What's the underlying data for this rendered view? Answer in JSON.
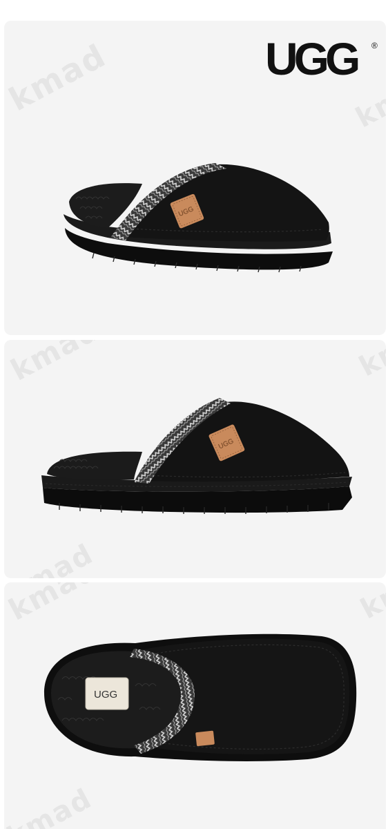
{
  "brand": {
    "logo_text": "UGG",
    "registered_mark": "®"
  },
  "watermark": {
    "text": "kmad"
  },
  "colors": {
    "background": "#ffffff",
    "panel": "#f4f4f4",
    "shoe_black": "#121212",
    "fur": "#1c1c1c",
    "trim_light": "#cfcfcf",
    "trim_dark": "#3a3a3a",
    "leather_tag": "#c98a5c",
    "fabric_label": "#ece6da"
  },
  "panels": [
    {
      "view": "side-angle"
    },
    {
      "view": "side-profile"
    },
    {
      "view": "top-down"
    }
  ],
  "tag_text": "UGG"
}
